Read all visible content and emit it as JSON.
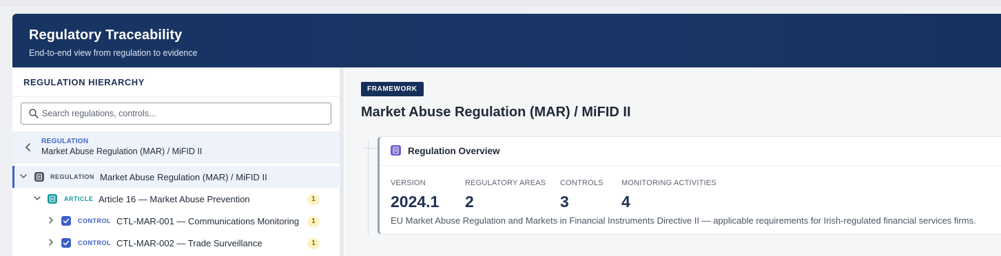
{
  "header": {
    "title": "Regulatory Traceability",
    "subtitle": "End-to-end view from regulation to evidence"
  },
  "sidebar": {
    "title": "REGULATION HIERARCHY",
    "search_placeholder": "Search regulations, controls...",
    "breadcrumb": {
      "label": "REGULATION",
      "name": "Market Abuse Regulation (MAR) / MiFID II"
    },
    "tree": [
      {
        "tag": "REGULATION",
        "title": "Market Abuse Regulation (MAR) / MiFID II",
        "expanded": true,
        "selected": true,
        "icon": "document-icon"
      },
      {
        "tag": "ARTICLE",
        "title": "Article 16 — Market Abuse Prevention",
        "count": "1",
        "expanded": true,
        "icon": "article-icon"
      },
      {
        "tag": "CONTROL",
        "title": "CTL-MAR-001 — Communications Monitoring",
        "count": "1",
        "expanded": false,
        "icon": "checkbox-icon"
      },
      {
        "tag": "CONTROL",
        "title": "CTL-MAR-002 — Trade Surveillance",
        "count": "1",
        "expanded": false,
        "icon": "checkbox-icon"
      }
    ]
  },
  "main": {
    "badge": "FRAMEWORK",
    "title": "Market Abuse Regulation (MAR) / MiFID II",
    "overview": {
      "heading": "Regulation Overview",
      "stats": [
        {
          "label": "VERSION",
          "value": "2024.1"
        },
        {
          "label": "REGULATORY AREAS",
          "value": "2"
        },
        {
          "label": "CONTROLS",
          "value": "3"
        },
        {
          "label": "MONITORING ACTIVITIES",
          "value": "4"
        }
      ],
      "description": "EU Market Abuse Regulation and Markets in Financial Instruments Directive II — applicable requirements for Irish-regulated financial services firms."
    }
  },
  "colors": {
    "header_bg": "#173462",
    "accent": "#3d63c7",
    "article": "#159aa2",
    "count_badge": "#fdf2c4"
  }
}
